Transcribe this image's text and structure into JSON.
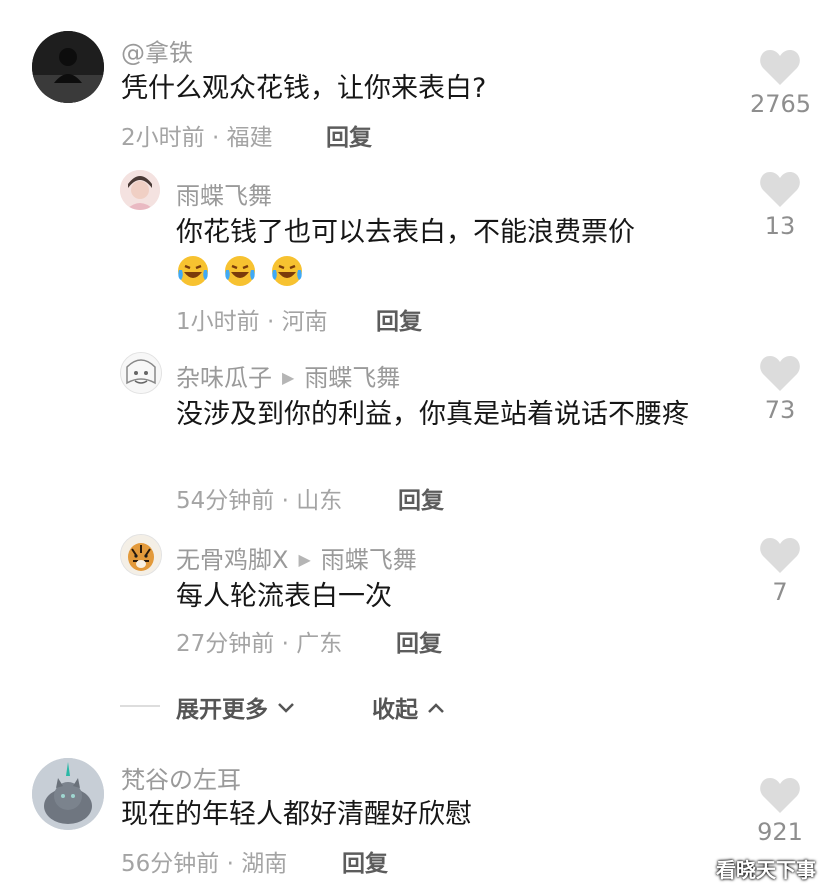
{
  "comments": [
    {
      "username": "@拿铁",
      "text": "凭什么观众花钱，让你来表白?",
      "meta": "2小时前 · 福建",
      "reply_label": "回复",
      "likes": "2765",
      "avatar": "dark-photo-avatar"
    },
    {
      "username": "雨蝶飞舞",
      "text": "你花钱了也可以去表白，不能浪费票价",
      "emojis": [
        "laughing-crying-emoji",
        "laughing-crying-emoji",
        "laughing-crying-emoji"
      ],
      "meta": "1小时前 · 河南",
      "reply_label": "回复",
      "likes": "13",
      "avatar": "person-photo-avatar"
    },
    {
      "username": "杂味瓜子",
      "reply_to": "雨蝶飞舞",
      "text": "没涉及到你的利益，你真是站着说话不腰疼",
      "meta": "54分钟前 · 山东",
      "reply_label": "回复",
      "likes": "73",
      "avatar": "sketch-avatar"
    },
    {
      "username": "无骨鸡脚X",
      "reply_to": "雨蝶飞舞",
      "text": "每人轮流表白一次",
      "meta": "27分钟前 · 广东",
      "reply_label": "回复",
      "likes": "7",
      "avatar": "tiger-avatar"
    },
    {
      "username": "梵谷の左耳",
      "text": "现在的年轻人都好清醒好欣慰",
      "meta": "56分钟前 · 湖南",
      "reply_label": "回复",
      "likes": "921",
      "avatar": "cat-photo-avatar"
    }
  ],
  "expand": {
    "more_label": "展开更多",
    "collapse_label": "收起"
  },
  "watermark": "看晓天下事",
  "colors": {
    "heart": "#dcdcdc",
    "text": "#161616",
    "secondary": "#9a9a9a"
  }
}
